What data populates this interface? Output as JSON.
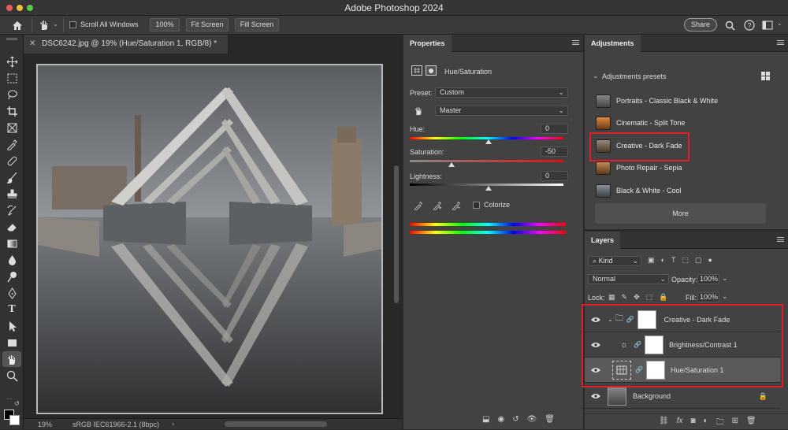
{
  "app": {
    "title": "Adobe Photoshop 2024"
  },
  "options_bar": {
    "scroll_all_windows": "Scroll All Windows",
    "zoom_btn": "100%",
    "fit_screen": "Fit Screen",
    "fill_screen": "Fill Screen",
    "share": "Share"
  },
  "document": {
    "tab_title": "DSC6242.jpg @ 19% (Hue/Saturation 1, RGB/8) *",
    "zoom": "19%",
    "profile": "sRGB IEC61966-2.1 (8bpc)"
  },
  "properties": {
    "tab": "Properties",
    "adjustment_name": "Hue/Saturation",
    "preset_label": "Preset:",
    "preset_value": "Custom",
    "channel_value": "Master",
    "hue_label": "Hue:",
    "hue_value": "0",
    "saturation_label": "Saturation:",
    "saturation_value": "-50",
    "lightness_label": "Lightness:",
    "lightness_value": "0",
    "colorize_label": "Colorize"
  },
  "adjustments": {
    "tab": "Adjustments",
    "presets_header": "Adjustments presets",
    "presets": [
      {
        "label": "Portraits - Classic Black & White",
        "color": "#7a7a7a"
      },
      {
        "label": "Cinematic - Split Tone",
        "color": "#c9702a"
      },
      {
        "label": "Creative - Dark Fade",
        "color": "#8a6a4a"
      },
      {
        "label": "Photo Repair - Sepia",
        "color": "#a0683a"
      },
      {
        "label": "Black & White - Cool",
        "color": "#6a7078"
      }
    ],
    "more_btn": "More"
  },
  "layers": {
    "tab": "Layers",
    "kind": "Kind",
    "blend_mode": "Normal",
    "opacity_label": "Opacity:",
    "opacity_value": "100%",
    "lock_label": "Lock:",
    "fill_label": "Fill:",
    "fill_value": "100%",
    "items": [
      {
        "name": "Creative - Dark Fade"
      },
      {
        "name": "Brightness/Contrast 1"
      },
      {
        "name": "Hue/Saturation 1"
      },
      {
        "name": "Background"
      }
    ]
  },
  "colors": {
    "highlight": "#e01e2a",
    "panel_bg": "#424242",
    "selected_layer": "#5a5a5a"
  }
}
